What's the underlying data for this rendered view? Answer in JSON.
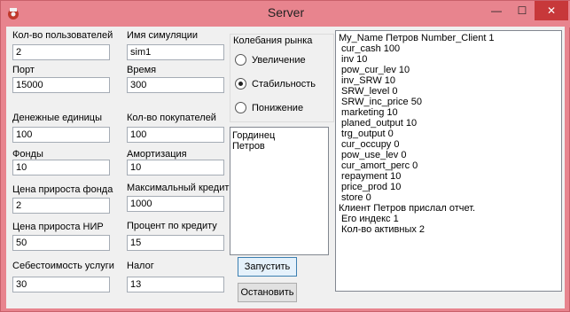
{
  "window": {
    "title": "Server",
    "controls": {
      "minimize": "—",
      "maximize": "☐",
      "close": "✕"
    }
  },
  "form": {
    "users_label": "Кол-во пользователей",
    "users_value": "2",
    "sim_name_label": "Имя симуляции",
    "sim_name_value": "sim1",
    "port_label": "Порт",
    "port_value": "15000",
    "time_label": "Время",
    "time_value": "300",
    "money_label": "Денежные единицы",
    "money_value": "100",
    "buyers_label": "Кол-во покупателей",
    "buyers_value": "100",
    "funds_label": "Фонды",
    "funds_value": "10",
    "amort_label": "Амортизация",
    "amort_value": "10",
    "fund_price_label": "Цена прироста фонда",
    "fund_price_value": "2",
    "max_credit_label": "Максимальный кредит",
    "max_credit_value": "1000",
    "rnd_price_label": "Цена прироста НИР",
    "rnd_price_value": "50",
    "credit_pct_label": "Процент по кредиту",
    "credit_pct_value": "15",
    "cost_label": "Себестоимость услуги",
    "cost_value": "30",
    "tax_label": "Налог",
    "tax_value": "13"
  },
  "market": {
    "title": "Колебания рынка",
    "options": [
      {
        "label": "Увеличение",
        "checked": false
      },
      {
        "label": "Стабильность",
        "checked": true
      },
      {
        "label": "Понижение",
        "checked": false
      }
    ]
  },
  "players": [
    "Гординец",
    "Петров"
  ],
  "buttons": {
    "start": "Запустить",
    "stop": "Остановить"
  },
  "log": [
    "My_Name Петров Number_Client 1",
    " cur_cash 100",
    " inv 10",
    " pow_cur_lev 10",
    " inv_SRW 10",
    " SRW_level 0",
    " SRW_inc_price 50",
    " marketing 10",
    " planed_output 10",
    " trg_output 0",
    " cur_occupy 0",
    " pow_use_lev 0",
    " cur_amort_perc 0",
    " repayment 10",
    " price_prod 10",
    " store 0",
    "Клиент Петров прислал отчет.",
    " Его индекс 1",
    " Кол-во активных 2"
  ]
}
